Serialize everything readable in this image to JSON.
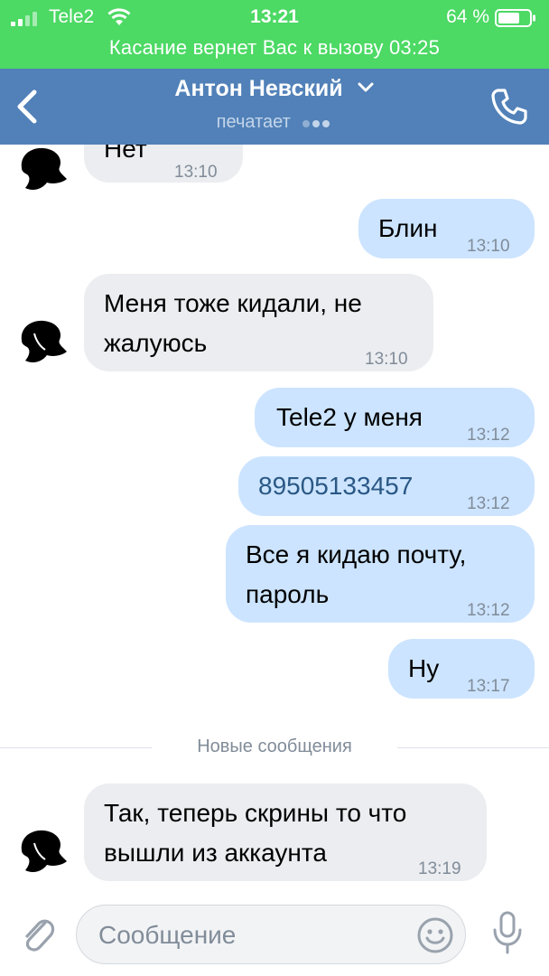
{
  "status_bar": {
    "carrier": "Tele2",
    "time": "13:21",
    "battery": "64 %",
    "return_text": "Касание вернет Вас к вызову 03:25"
  },
  "header": {
    "title": "Антон Невский",
    "subtitle": "печатает"
  },
  "messages": [
    {
      "dir": "in",
      "text": "Нет",
      "time": "13:10"
    },
    {
      "dir": "out",
      "text": "Блин",
      "time": "13:10"
    },
    {
      "dir": "in",
      "text": "Меня тоже кидали, не",
      "text2": "жалуюсь",
      "time": "13:10"
    },
    {
      "dir": "out",
      "text": "Tele2 у меня",
      "time": "13:12"
    },
    {
      "dir": "out",
      "text": "89505133457",
      "time": "13:12"
    },
    {
      "dir": "out",
      "text": "Все я кидаю почту,",
      "text2": "пароль",
      "time": "13:12"
    },
    {
      "dir": "out",
      "text": "Ну",
      "time": "13:17"
    },
    {
      "dir": "in",
      "text": "Так, теперь скрины то что",
      "text2": "вышли из аккаунта",
      "time": "13:19"
    }
  ],
  "divider": "Новые сообщения",
  "composer": {
    "placeholder": "Сообщение",
    "value": ""
  },
  "colors": {
    "status_green": "#4cd964",
    "header_blue": "#5181b8",
    "incoming_bubble": "#ebedf0",
    "outgoing_bubble": "#cce4ff",
    "link": "#2a5885"
  },
  "icons": [
    "signal-icon",
    "wifi-icon",
    "battery-icon",
    "back-icon",
    "chevron-down-icon",
    "phone-icon",
    "avatar-icon",
    "attach-icon",
    "smile-icon",
    "mic-icon"
  ]
}
